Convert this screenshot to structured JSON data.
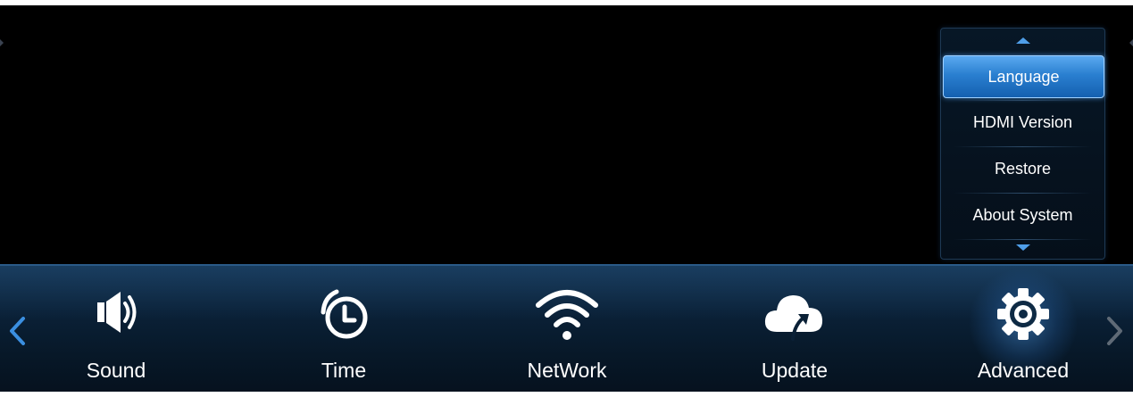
{
  "submenu": {
    "items": [
      {
        "label": "Language",
        "selected": true
      },
      {
        "label": "HDMI Version",
        "selected": false
      },
      {
        "label": "Restore",
        "selected": false
      },
      {
        "label": "About System",
        "selected": false
      }
    ],
    "scroll_up_icon": "triangle-up-icon",
    "scroll_down_icon": "triangle-down-icon"
  },
  "bottom_bar": {
    "tabs": [
      {
        "label": "Sound",
        "icon": "speaker-icon"
      },
      {
        "label": "Time",
        "icon": "clock-icon"
      },
      {
        "label": "NetWork",
        "icon": "wifi-icon"
      },
      {
        "label": "Update",
        "icon": "cloud-upload-icon"
      },
      {
        "label": "Advanced",
        "icon": "gear-icon",
        "active": true
      }
    ],
    "prev_icon": "chevron-left-icon",
    "next_icon": "chevron-right-icon"
  },
  "colors": {
    "accent": "#3b8fe0",
    "selected_item": "#2a7fd0",
    "bar_background": "#0a2036",
    "text": "#ffffff"
  }
}
